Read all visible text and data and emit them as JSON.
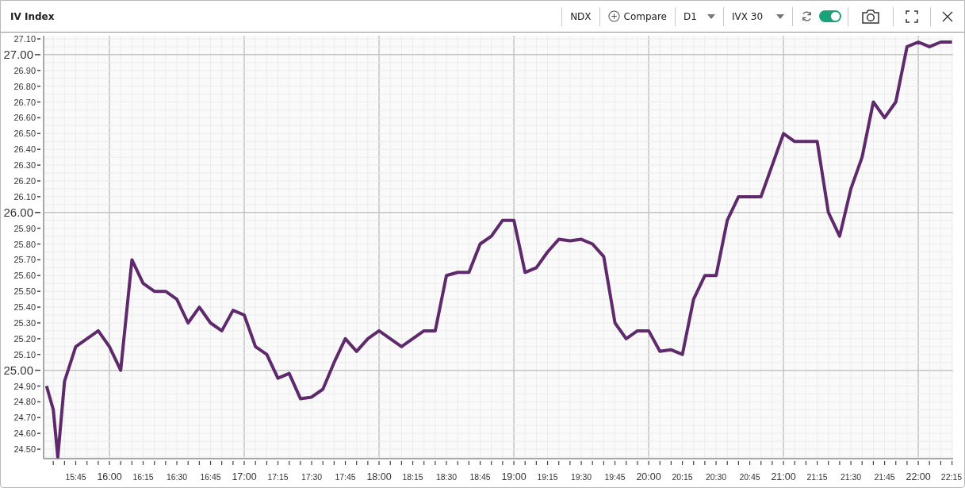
{
  "window": {
    "title": "IV Index"
  },
  "toolbar": {
    "symbol": "NDX",
    "compare": {
      "label": "Compare"
    },
    "period": {
      "value": "D1"
    },
    "measure": {
      "value": "IVX 30"
    },
    "auto_refresh": {
      "on": true
    }
  },
  "chart": {
    "chart_data": {
      "type": "line",
      "x": [
        932,
        935,
        937,
        940,
        945,
        950,
        955,
        960,
        965,
        970,
        975,
        980,
        985,
        990,
        995,
        1000,
        1005,
        1010,
        1015,
        1020,
        1025,
        1030,
        1035,
        1040,
        1045,
        1050,
        1055,
        1060,
        1065,
        1070,
        1075,
        1080,
        1085,
        1090,
        1095,
        1100,
        1105,
        1110,
        1115,
        1120,
        1125,
        1130,
        1135,
        1140,
        1145,
        1150,
        1155,
        1160,
        1165,
        1170,
        1175,
        1180,
        1185,
        1190,
        1195,
        1200,
        1205,
        1210,
        1215,
        1220,
        1225,
        1230,
        1235,
        1240,
        1245,
        1250,
        1255,
        1260,
        1265,
        1270,
        1275,
        1280,
        1285,
        1290,
        1295,
        1300,
        1305,
        1310,
        1315,
        1320,
        1325,
        1330,
        1335
      ],
      "series": [
        {
          "color": "#5e2a6c",
          "values": [
            24.9,
            24.75,
            24.45,
            24.93,
            25.15,
            25.2,
            25.25,
            25.15,
            25.0,
            25.7,
            25.55,
            25.5,
            25.5,
            25.45,
            25.3,
            25.4,
            25.3,
            25.25,
            25.38,
            25.35,
            25.15,
            25.1,
            24.95,
            24.98,
            24.82,
            24.83,
            24.88,
            25.05,
            25.2,
            25.12,
            25.2,
            25.25,
            25.2,
            25.15,
            25.2,
            25.25,
            25.25,
            25.6,
            25.62,
            25.62,
            25.8,
            25.85,
            25.95,
            25.95,
            25.62,
            25.65,
            25.75,
            25.83,
            25.82,
            25.83,
            25.8,
            25.72,
            25.3,
            25.2,
            25.25,
            25.25,
            25.12,
            25.13,
            25.1,
            25.45,
            25.6,
            25.6,
            25.95,
            26.1,
            26.1,
            26.1,
            26.3,
            26.5,
            26.45,
            26.45,
            26.45,
            26.0,
            25.85,
            26.15,
            26.35,
            26.7,
            26.6,
            26.7,
            27.05,
            27.08,
            27.05,
            27.08,
            27.08
          ]
        }
      ],
      "xlim": [
        930.7,
        1335.5
      ],
      "ylim": [
        24.44,
        27.12
      ],
      "grid": true,
      "xticks": [
        {
          "value": 945,
          "label": "15:45"
        },
        {
          "value": 960,
          "label": "16:00"
        },
        {
          "value": 975,
          "label": "16:15"
        },
        {
          "value": 990,
          "label": "16:30"
        },
        {
          "value": 1005,
          "label": "16:45"
        },
        {
          "value": 1020,
          "label": "17:00"
        },
        {
          "value": 1035,
          "label": "17:15"
        },
        {
          "value": 1050,
          "label": "17:30"
        },
        {
          "value": 1065,
          "label": "17:45"
        },
        {
          "value": 1080,
          "label": "18:00"
        },
        {
          "value": 1095,
          "label": "18:15"
        },
        {
          "value": 1110,
          "label": "18:30"
        },
        {
          "value": 1125,
          "label": "18:45"
        },
        {
          "value": 1140,
          "label": "19:00"
        },
        {
          "value": 1155,
          "label": "19:15"
        },
        {
          "value": 1170,
          "label": "19:30"
        },
        {
          "value": 1185,
          "label": "19:45"
        },
        {
          "value": 1200,
          "label": "20:00"
        },
        {
          "value": 1215,
          "label": "20:15"
        },
        {
          "value": 1230,
          "label": "20:30"
        },
        {
          "value": 1245,
          "label": "20:45"
        },
        {
          "value": 1260,
          "label": "21:00"
        },
        {
          "value": 1275,
          "label": "21:15"
        },
        {
          "value": 1290,
          "label": "21:30"
        },
        {
          "value": 1305,
          "label": "21:45"
        },
        {
          "value": 1320,
          "label": "22:00"
        },
        {
          "value": 1335,
          "label": "22:15"
        }
      ],
      "yticks": [
        {
          "value": 24.5,
          "label": "24.50"
        },
        {
          "value": 24.6,
          "label": "24.60"
        },
        {
          "value": 24.7,
          "label": "24.70"
        },
        {
          "value": 24.8,
          "label": "24.80"
        },
        {
          "value": 24.9,
          "label": "24.90"
        },
        {
          "value": 25.0,
          "label": "25.00"
        },
        {
          "value": 25.1,
          "label": "25.10"
        },
        {
          "value": 25.2,
          "label": "25.20"
        },
        {
          "value": 25.3,
          "label": "25.30"
        },
        {
          "value": 25.4,
          "label": "25.40"
        },
        {
          "value": 25.5,
          "label": "25.50"
        },
        {
          "value": 25.6,
          "label": "25.60"
        },
        {
          "value": 25.7,
          "label": "25.70"
        },
        {
          "value": 25.8,
          "label": "25.80"
        },
        {
          "value": 25.9,
          "label": "25.90"
        },
        {
          "value": 26.0,
          "label": "26.00"
        },
        {
          "value": 26.1,
          "label": "26.10"
        },
        {
          "value": 26.2,
          "label": "26.20"
        },
        {
          "value": 26.3,
          "label": "26.30"
        },
        {
          "value": 26.4,
          "label": "26.40"
        },
        {
          "value": 26.5,
          "label": "26.50"
        },
        {
          "value": 26.6,
          "label": "26.60"
        },
        {
          "value": 26.7,
          "label": "26.70"
        },
        {
          "value": 26.8,
          "label": "26.80"
        },
        {
          "value": 26.9,
          "label": "26.90"
        },
        {
          "value": 27.0,
          "label": "27.00"
        },
        {
          "value": 27.1,
          "label": "27.10"
        }
      ]
    }
  }
}
